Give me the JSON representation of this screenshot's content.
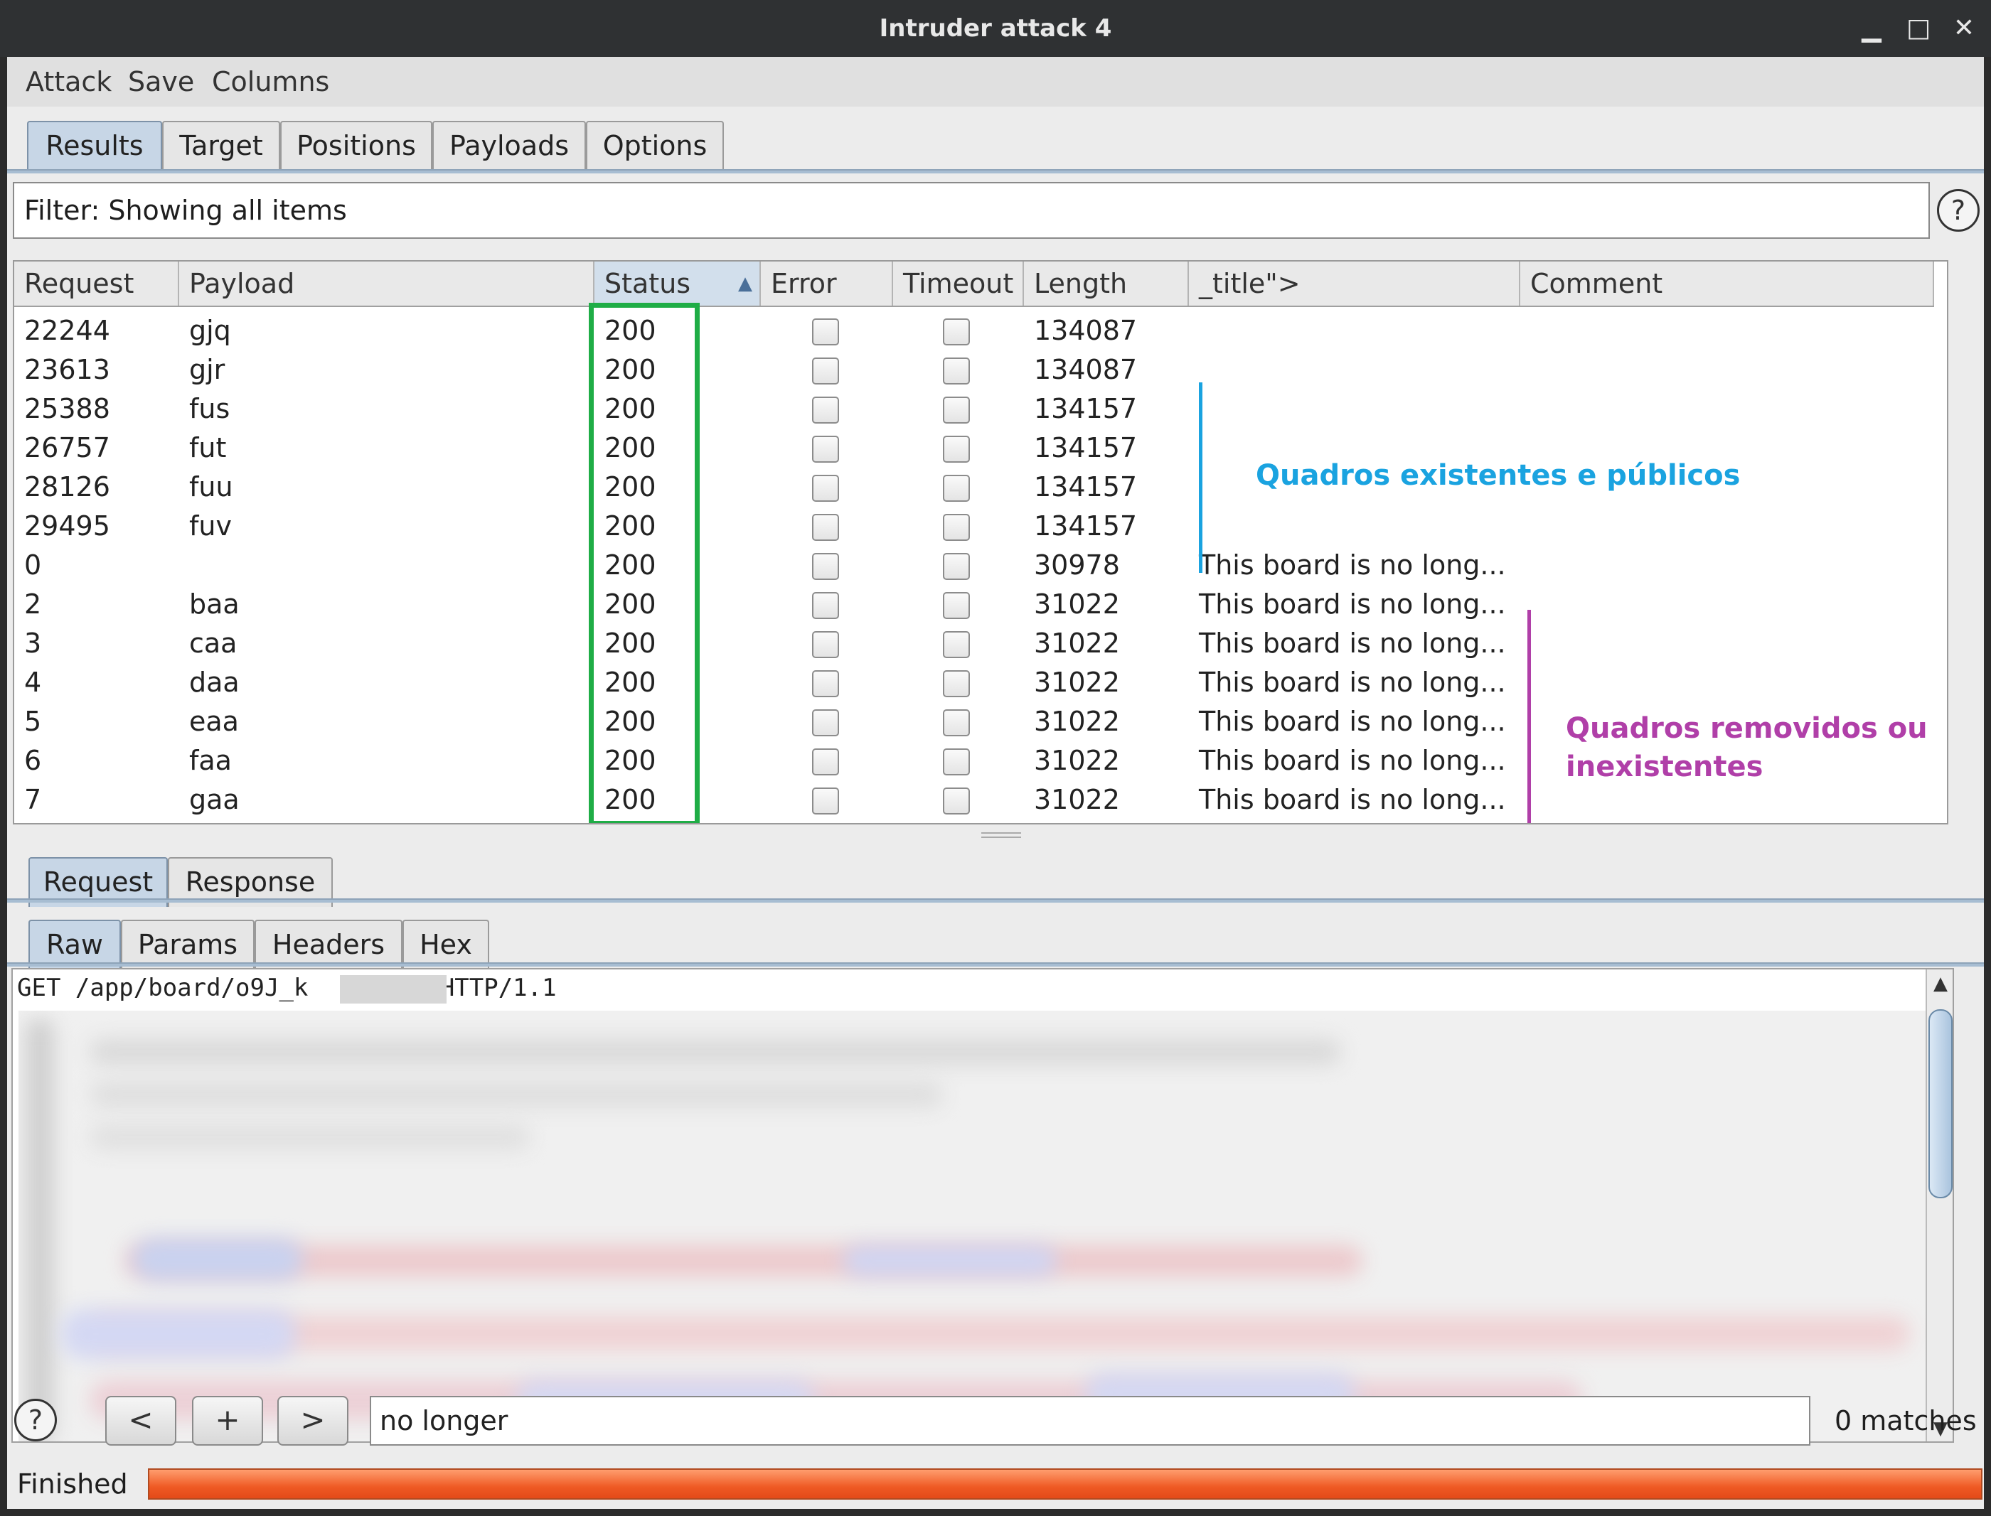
{
  "window": {
    "title": "Intruder attack 4",
    "minimize_glyph": "▁",
    "maximize_glyph": "□",
    "close_glyph": "✕"
  },
  "menu": [
    "Attack",
    "Save",
    "Columns"
  ],
  "main_tabs": [
    {
      "label": "Results",
      "active": true
    },
    {
      "label": "Target",
      "active": false
    },
    {
      "label": "Positions",
      "active": false
    },
    {
      "label": "Payloads",
      "active": false
    },
    {
      "label": "Options",
      "active": false
    }
  ],
  "filter": {
    "text": "Filter: Showing all items",
    "help_glyph": "?"
  },
  "table": {
    "columns": [
      "Request",
      "Payload",
      "Status",
      "Error",
      "Timeout",
      "Length",
      "_title\">",
      "Comment"
    ],
    "sort_indicator": "▲",
    "rows": [
      {
        "request": "22244",
        "payload": "gjq",
        "status": "200",
        "length": "134087",
        "title": ""
      },
      {
        "request": "23613",
        "payload": "gjr",
        "status": "200",
        "length": "134087",
        "title": ""
      },
      {
        "request": "25388",
        "payload": "fus",
        "status": "200",
        "length": "134157",
        "title": ""
      },
      {
        "request": "26757",
        "payload": "fut",
        "status": "200",
        "length": "134157",
        "title": ""
      },
      {
        "request": "28126",
        "payload": "fuu",
        "status": "200",
        "length": "134157",
        "title": ""
      },
      {
        "request": "29495",
        "payload": "fuv",
        "status": "200",
        "length": "134157",
        "title": ""
      },
      {
        "request": "0",
        "payload": "",
        "status": "200",
        "length": "30978",
        "title": "This board is no long..."
      },
      {
        "request": "2",
        "payload": "baa",
        "status": "200",
        "length": "31022",
        "title": "This board is no long..."
      },
      {
        "request": "3",
        "payload": "caa",
        "status": "200",
        "length": "31022",
        "title": "This board is no long..."
      },
      {
        "request": "4",
        "payload": "daa",
        "status": "200",
        "length": "31022",
        "title": "This board is no long..."
      },
      {
        "request": "5",
        "payload": "eaa",
        "status": "200",
        "length": "31022",
        "title": "This board is no long..."
      },
      {
        "request": "6",
        "payload": "faa",
        "status": "200",
        "length": "31022",
        "title": "This board is no long..."
      },
      {
        "request": "7",
        "payload": "gaa",
        "status": "200",
        "length": "31022",
        "title": "This board is no long..."
      }
    ]
  },
  "annotations": {
    "existing": {
      "text": "Quadros existentes e públicos",
      "color": "#1aa3e0"
    },
    "removed": {
      "line1": "Quadros removidos ou",
      "line2": "inexistentes",
      "color": "#b03fa8"
    },
    "status_highlight_color": "#1fad46"
  },
  "message_tabs": [
    {
      "label": "Request",
      "active": true
    },
    {
      "label": "Response",
      "active": false
    }
  ],
  "view_tabs": [
    {
      "label": "Raw",
      "active": true
    },
    {
      "label": "Params",
      "active": false
    },
    {
      "label": "Headers",
      "active": false
    },
    {
      "label": "Hex",
      "active": false
    }
  ],
  "request_editor": {
    "first_line_start": "GET /app/board/o9J_k",
    "first_line_end": "=/ HTTP/1.1"
  },
  "search": {
    "help_glyph": "?",
    "prev": "<",
    "add": "+",
    "next": ">",
    "value": "no longer",
    "matches": "0 matches"
  },
  "status": {
    "text": "Finished",
    "progress": 1.0,
    "progress_color": "#ef5a24"
  }
}
